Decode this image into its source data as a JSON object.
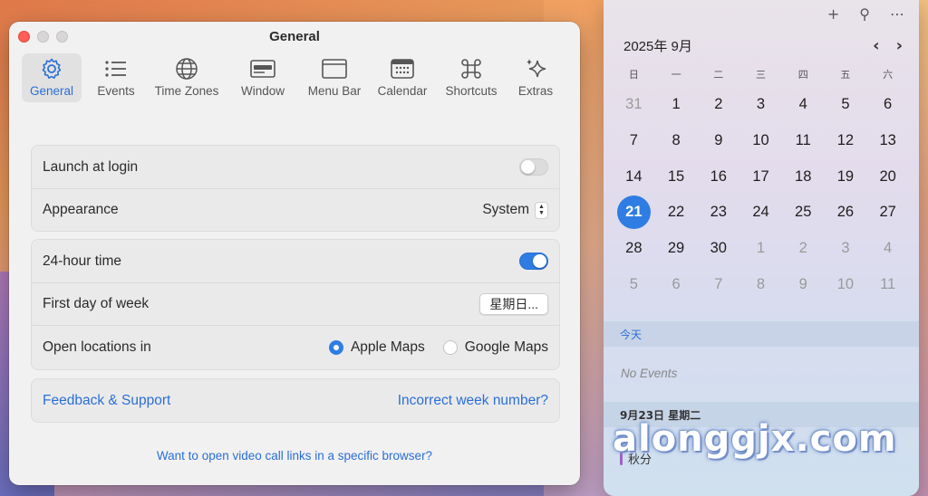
{
  "window": {
    "title": "General",
    "toolbar": [
      {
        "label": "General",
        "icon": "gear-icon",
        "active": true
      },
      {
        "label": "Events",
        "icon": "list-icon"
      },
      {
        "label": "Time Zones",
        "icon": "globe-icon"
      },
      {
        "label": "Window",
        "icon": "window-icon"
      },
      {
        "label": "Menu Bar",
        "icon": "menubar-icon"
      },
      {
        "label": "Calendar",
        "icon": "calendar-icon"
      },
      {
        "label": "Shortcuts",
        "icon": "command-icon"
      },
      {
        "label": "Extras",
        "icon": "sparkles-icon"
      }
    ],
    "launch_at_login": {
      "label": "Launch at login",
      "on": false
    },
    "appearance": {
      "label": "Appearance",
      "value": "System"
    },
    "hour24": {
      "label": "24-hour time",
      "on": true
    },
    "first_day": {
      "label": "First day of week",
      "value": "星期日..."
    },
    "open_locations": {
      "label": "Open locations in",
      "options": [
        "Apple Maps",
        "Google Maps"
      ],
      "selected": "Apple Maps"
    },
    "feedback": "Feedback & Support",
    "week_number": "Incorrect week number?",
    "footer_link": "Want to open video call links in a specific browser?"
  },
  "calendar": {
    "top_icons": [
      "plus-icon",
      "pin-icon",
      "more-icon"
    ],
    "top_glyphs": [
      "+",
      "⚲",
      "⋯"
    ],
    "month": "2025年 9月",
    "nav": [
      "‹",
      "›"
    ],
    "weekdays": [
      "日",
      "一",
      "二",
      "三",
      "四",
      "五",
      "六"
    ],
    "weeks": [
      [
        {
          "d": "31",
          "out": true
        },
        {
          "d": "1"
        },
        {
          "d": "2"
        },
        {
          "d": "3"
        },
        {
          "d": "4"
        },
        {
          "d": "5"
        },
        {
          "d": "6"
        }
      ],
      [
        {
          "d": "7"
        },
        {
          "d": "8"
        },
        {
          "d": "9"
        },
        {
          "d": "10"
        },
        {
          "d": "11"
        },
        {
          "d": "12"
        },
        {
          "d": "13"
        }
      ],
      [
        {
          "d": "14"
        },
        {
          "d": "15"
        },
        {
          "d": "16"
        },
        {
          "d": "17"
        },
        {
          "d": "18"
        },
        {
          "d": "19"
        },
        {
          "d": "20"
        }
      ],
      [
        {
          "d": "21",
          "selected": true
        },
        {
          "d": "22"
        },
        {
          "d": "23"
        },
        {
          "d": "24"
        },
        {
          "d": "25"
        },
        {
          "d": "26"
        },
        {
          "d": "27"
        }
      ],
      [
        {
          "d": "28"
        },
        {
          "d": "29"
        },
        {
          "d": "30"
        },
        {
          "d": "1",
          "out": true
        },
        {
          "d": "2",
          "out": true
        },
        {
          "d": "3",
          "out": true
        },
        {
          "d": "4",
          "out": true
        }
      ],
      [
        {
          "d": "5",
          "out": true
        },
        {
          "d": "6",
          "out": true
        },
        {
          "d": "7",
          "out": true
        },
        {
          "d": "8",
          "out": true
        },
        {
          "d": "9",
          "out": true
        },
        {
          "d": "10",
          "out": true
        },
        {
          "d": "11",
          "out": true
        }
      ]
    ],
    "today_label": "今天",
    "no_events": "No Events",
    "next_date": "9月23日 星期二",
    "next_event": "秋分"
  },
  "watermark": "alonggjx.com",
  "colors": {
    "accent": "#2f7de3",
    "link": "#2a6fd6"
  }
}
